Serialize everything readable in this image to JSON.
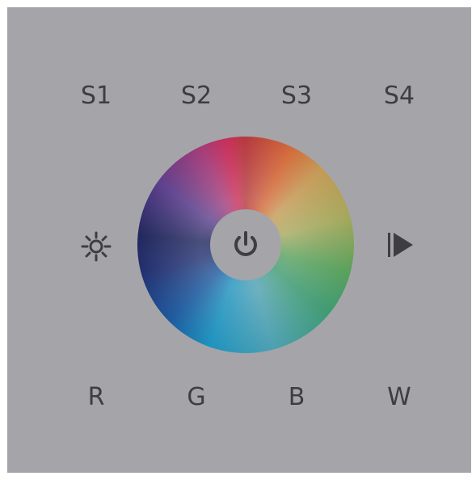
{
  "scene_buttons": [
    {
      "label": "S1"
    },
    {
      "label": "S2"
    },
    {
      "label": "S3"
    },
    {
      "label": "S4"
    }
  ],
  "channel_buttons": [
    {
      "label": "R"
    },
    {
      "label": "G"
    },
    {
      "label": "B"
    },
    {
      "label": "W"
    }
  ],
  "icons": {
    "left": "brightness-icon",
    "right": "play-icon",
    "center": "power-icon"
  },
  "colors": {
    "panel": "#a5a5a9",
    "text": "#3d3d42"
  }
}
